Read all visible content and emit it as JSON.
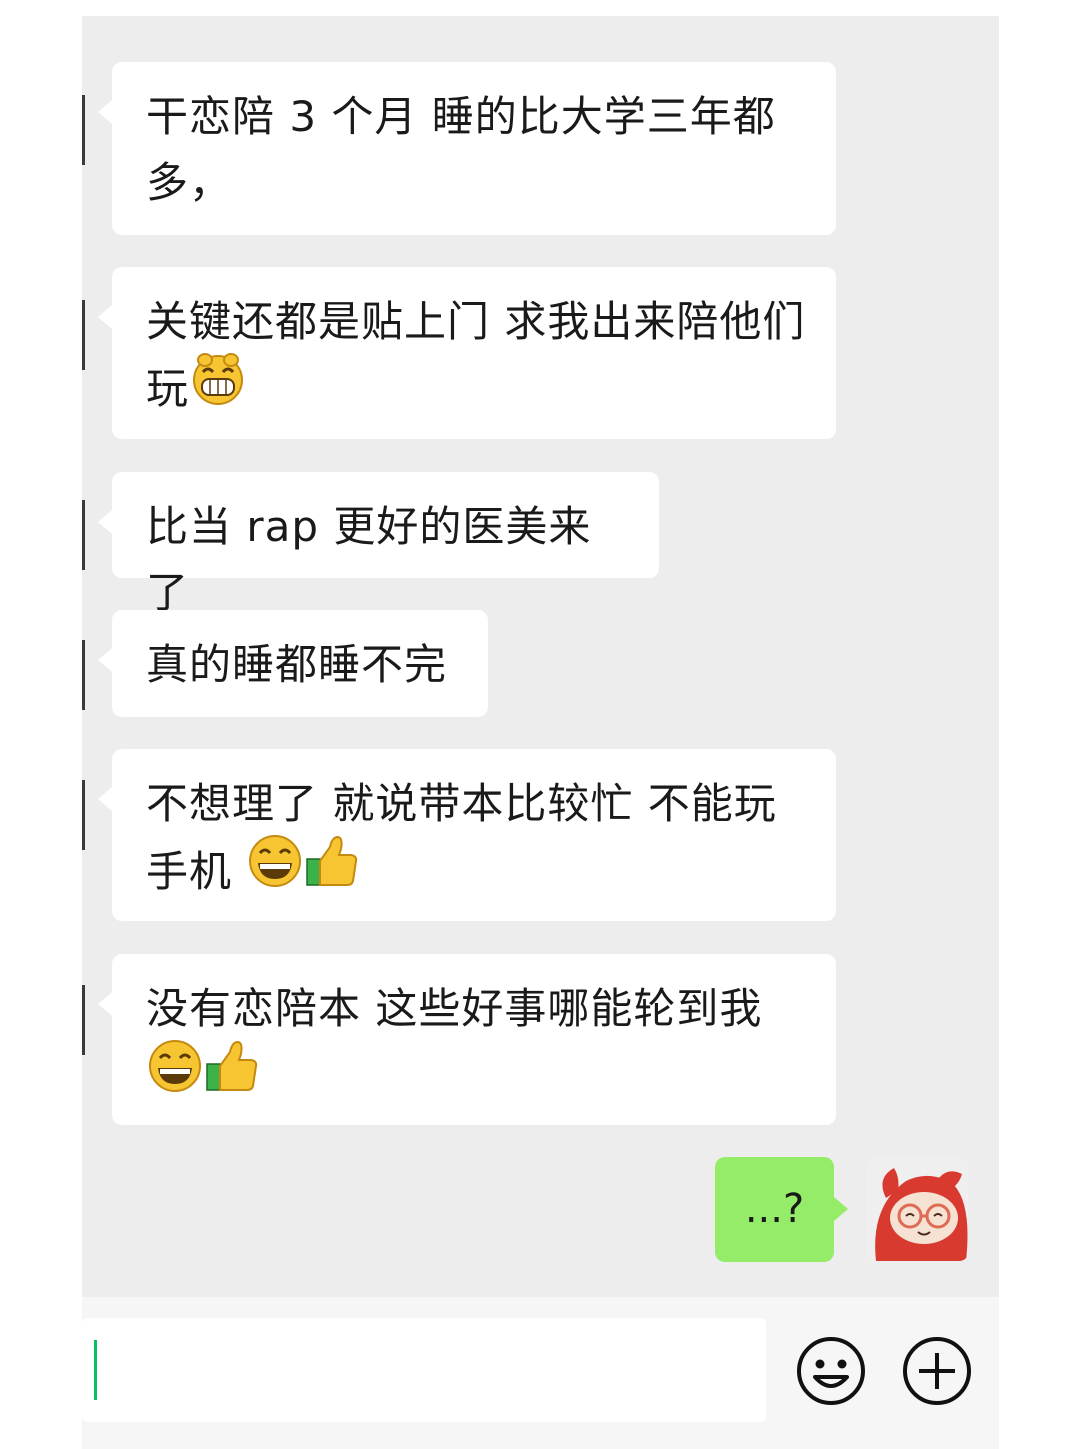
{
  "messages": [
    {
      "text": "干恋陪 3 个月  睡的比大学三年都多，",
      "emojis": []
    },
    {
      "text": "关键还都是贴上门  求我出来陪他们玩",
      "emojis": [
        "grin-emoji"
      ]
    },
    {
      "text": "比当 rap 更好的医美来了",
      "emojis": []
    },
    {
      "text": "真的睡都睡不完",
      "emojis": []
    },
    {
      "text": "不想理了  就说带本比较忙  不能玩手机 ",
      "emojis": [
        "smile-emoji",
        "thumbs-up-emoji"
      ]
    },
    {
      "text": "没有恋陪本  这些好事哪能轮到我",
      "emojis": [
        "smile-emoji",
        "thumbs-up-emoji"
      ]
    }
  ],
  "my_message": {
    "text": "...?"
  },
  "input": {
    "value": "",
    "placeholder": ""
  },
  "icons": {
    "emoji_button": "smiley-face-icon",
    "more_button": "plus-circle-icon",
    "avatar": "red-cartoon-avatar"
  },
  "colors": {
    "chat_background": "#ededed",
    "incoming_bubble": "#ffffff",
    "outgoing_bubble": "#95ec69",
    "caret": "#07c160"
  }
}
